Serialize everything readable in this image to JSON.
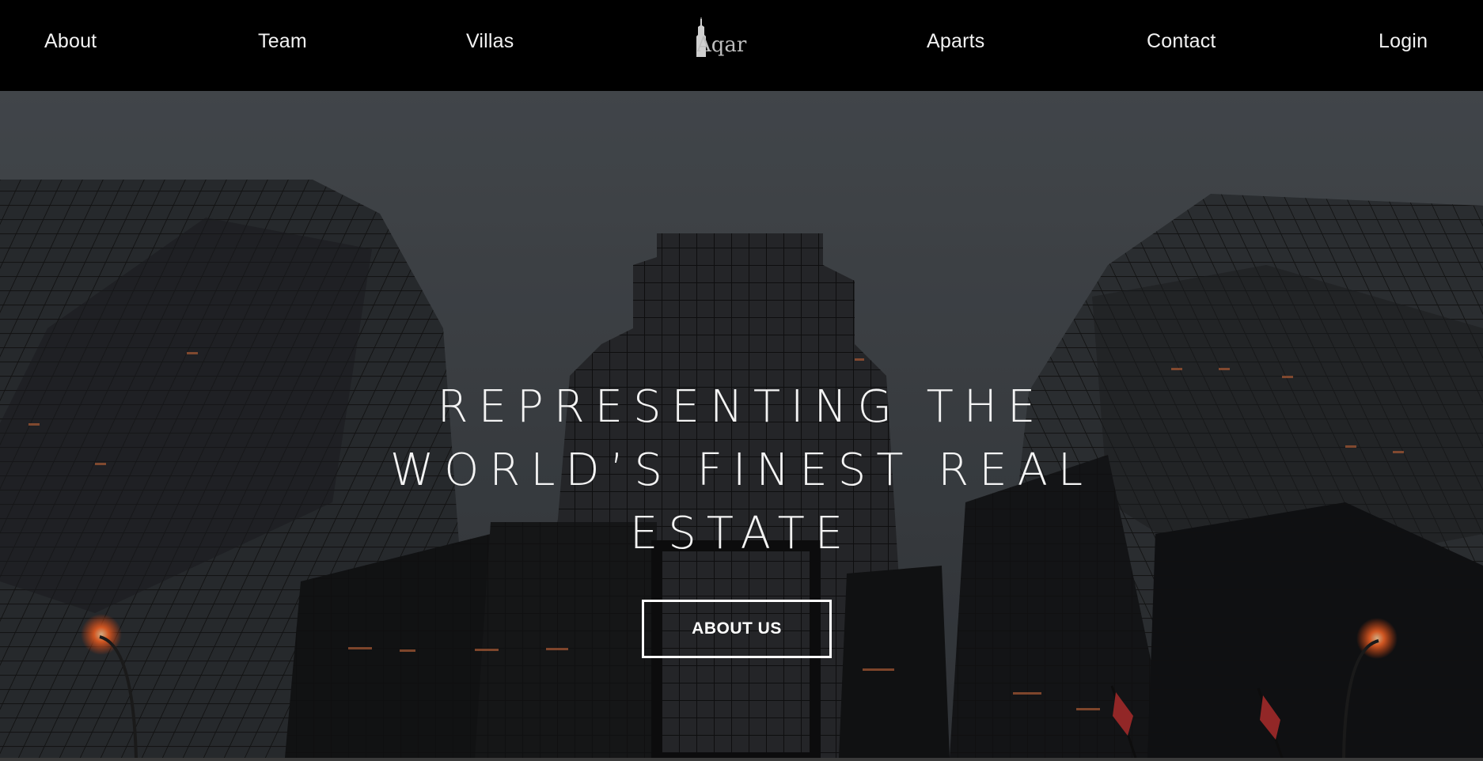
{
  "nav": {
    "about": "About",
    "team": "Team",
    "villas": "Villas",
    "aparts": "Aparts",
    "contact": "Contact",
    "login": "Login"
  },
  "logo": {
    "text": "Aqar"
  },
  "hero": {
    "title_lines": [
      "REPRESENTING THE",
      "WORLD’S FINEST REAL",
      "ESTATE"
    ],
    "button_label": "ABOUT US"
  },
  "colors": {
    "navbar_bg": "#000000",
    "text": "#ffffff",
    "logo": "#bdbdbd"
  }
}
